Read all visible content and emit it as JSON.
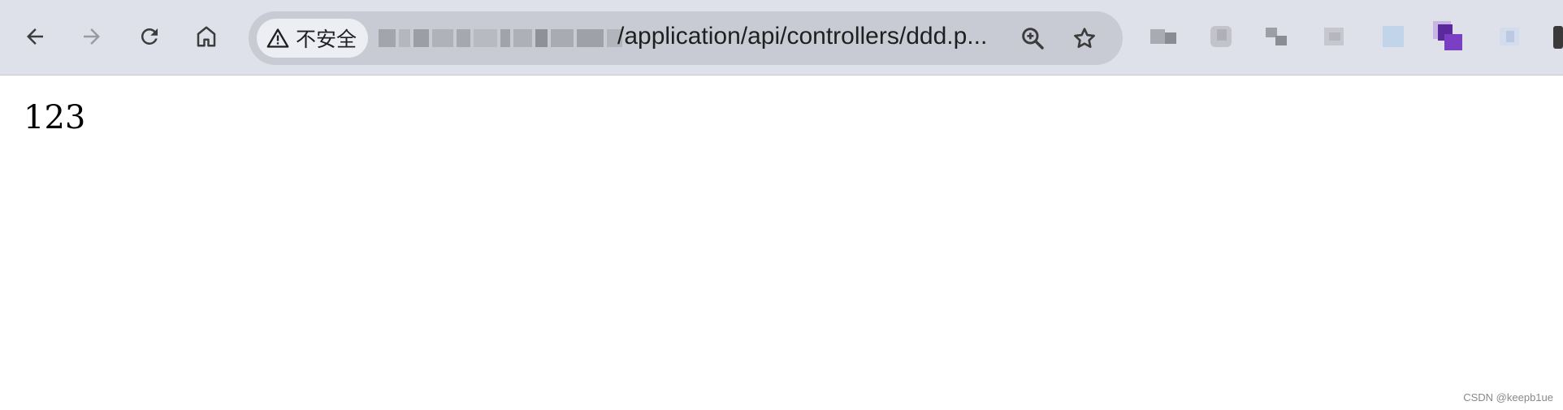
{
  "browser": {
    "nav": {
      "back_icon": "arrow-left-icon",
      "forward_icon": "arrow-right-icon",
      "reload_icon": "reload-icon",
      "home_icon": "home-icon"
    },
    "omnibox": {
      "security_label": "不安全",
      "security_icon": "warning-triangle-icon",
      "url_visible": "/application/api/controllers/ddd.p..."
    },
    "omni_actions": {
      "zoom_icon": "zoom-in-icon",
      "bookmark_icon": "star-icon"
    },
    "extensions": [
      "extension-1",
      "extension-2",
      "extension-3",
      "extension-4",
      "extension-5",
      "extension-6",
      "extension-7",
      "extension-8"
    ]
  },
  "page": {
    "body_text": "123"
  },
  "watermark": {
    "text": "CSDN @keepb1ue"
  },
  "colors": {
    "toolbar_bg": "#dfe1ea",
    "omnibox_bg": "#c9cbd4",
    "security_chip_bg": "#eceef4",
    "extension_accent": "#7b3fc4"
  }
}
